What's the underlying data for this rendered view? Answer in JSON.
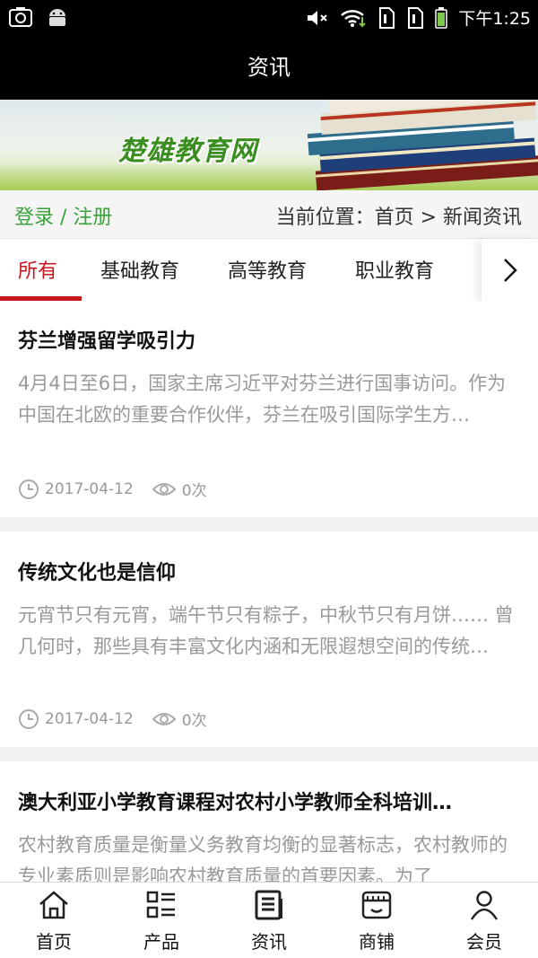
{
  "status": {
    "time": "下午1:25"
  },
  "header": {
    "title": "资讯"
  },
  "banner": {
    "logo_text": "楚雄教育网"
  },
  "location": {
    "login": "登录 / 注册",
    "breadcrumb": "当前位置：首页 > 新闻资讯"
  },
  "tabs": [
    {
      "label": "所有",
      "active": true
    },
    {
      "label": "基础教育",
      "active": false
    },
    {
      "label": "高等教育",
      "active": false
    },
    {
      "label": "职业教育",
      "active": false
    }
  ],
  "articles": [
    {
      "title": "芬兰增强留学吸引力",
      "summary": "4月4日至6日，国家主席习近平对芬兰进行国事访问。作为中国在北欧的重要合作伙伴，芬兰在吸引国际学生方…",
      "date": "2017-04-12",
      "views": "0次"
    },
    {
      "title": "传统文化也是信仰",
      "summary": "元宵节只有元宵，端午节只有粽子，中秋节只有月饼…… 曾几何时，那些具有丰富文化内涵和无限遐想空间的传统…",
      "date": "2017-04-12",
      "views": "0次"
    },
    {
      "title": "澳大利亚小学教育课程对农村小学教师全科培训…",
      "summary": "农村教育质量是衡量义务教育均衡的显著标志，农村教师的专业素质则是影响农村教育质量的首要因素。为了",
      "date": "",
      "views": ""
    }
  ],
  "bottom_nav": [
    {
      "label": "首页",
      "icon": "home-icon"
    },
    {
      "label": "产品",
      "icon": "product-list-icon"
    },
    {
      "label": "资讯",
      "icon": "news-icon"
    },
    {
      "label": "商铺",
      "icon": "shop-icon"
    },
    {
      "label": "会员",
      "icon": "member-icon"
    }
  ],
  "colors": {
    "accent": "#c7161d",
    "login_green": "#3aa33a",
    "header_bg": "#000000"
  }
}
